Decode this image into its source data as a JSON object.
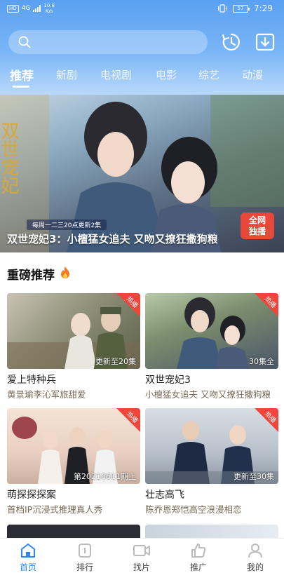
{
  "status_bar": {
    "hd": "HD",
    "network": "4G",
    "speed_value": "10.8",
    "speed_unit": "K/s",
    "battery": "57",
    "time": "7:29"
  },
  "header": {
    "icons": [
      "search-icon",
      "history-icon",
      "download-icon"
    ],
    "tabs": [
      "推荐",
      "新剧",
      "电视剧",
      "电影",
      "综艺",
      "动漫"
    ],
    "active_tab": "推荐",
    "accent": "#2f86f0"
  },
  "banner": {
    "update_note": "每周一二三20点更新2集",
    "caption": "双世宠妃3：小檀猛女追夫 又吻又撩狂撒狗粮",
    "logo_text": "双世宠妃",
    "badge_line1": "全网",
    "badge_line2": "独播"
  },
  "section": {
    "title": "重磅推荐",
    "icon": "fire-icon"
  },
  "cards": [
    {
      "title": "爱上特种兵",
      "desc": "黄景瑜李沁军旅甜爱",
      "episode": "更新至20集",
      "tag": "热播"
    },
    {
      "title": "双世宠妃3",
      "desc": "小檀猛女追夫 又吻又撩狂撒狗粮",
      "episode": "30集全",
      "tag": "热播"
    },
    {
      "title": "萌探探探案",
      "desc": "首档IP沉浸式推理真人秀",
      "episode": "第20210611期上",
      "tag": "热播"
    },
    {
      "title": "壮志高飞",
      "desc": "陈乔恩郑恺高空浪漫相恋",
      "episode": "更新至30集",
      "tag": "热播"
    }
  ],
  "bottom_nav": [
    {
      "label": "首页",
      "icon": "home-icon",
      "active": true
    },
    {
      "label": "排行",
      "icon": "ranking-icon",
      "active": false
    },
    {
      "label": "找片",
      "icon": "video-icon",
      "active": false
    },
    {
      "label": "推广",
      "icon": "thumbs-up-icon",
      "active": false
    },
    {
      "label": "我的",
      "icon": "profile-icon",
      "active": false
    }
  ]
}
